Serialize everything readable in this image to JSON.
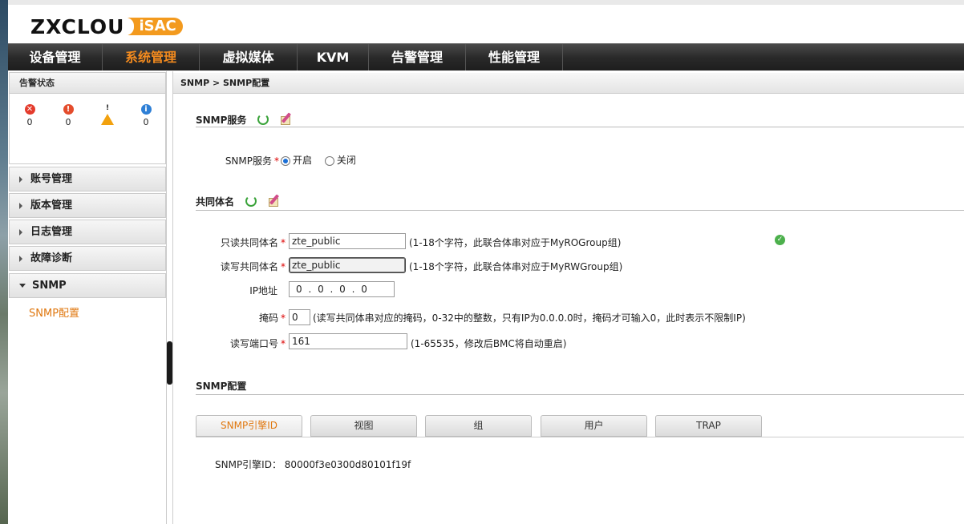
{
  "logo": {
    "text": "ZXCLOU",
    "mark": "iSAC"
  },
  "nav": {
    "items": [
      {
        "label": "设备管理",
        "active": false
      },
      {
        "label": "系统管理",
        "active": true
      },
      {
        "label": "虚拟媒体",
        "active": false
      },
      {
        "label": "KVM",
        "active": false
      },
      {
        "label": "告警管理",
        "active": false
      },
      {
        "label": "性能管理",
        "active": false
      }
    ]
  },
  "sidebar": {
    "alarm_title": "告警状态",
    "alarms": [
      {
        "icon": "critical-alarm-icon",
        "count": "0"
      },
      {
        "icon": "major-alarm-icon",
        "count": "0"
      },
      {
        "icon": "minor-alarm-icon",
        "count": "0"
      },
      {
        "icon": "info-alarm-icon",
        "count": "0"
      }
    ],
    "menu": [
      {
        "label": "账号管理"
      },
      {
        "label": "版本管理"
      },
      {
        "label": "日志管理"
      },
      {
        "label": "故障诊断"
      },
      {
        "label": "SNMP"
      }
    ],
    "submenu": {
      "label": "SNMP配置"
    }
  },
  "breadcrumb": "SNMP > SNMP配置",
  "snmp_service": {
    "section_title": "SNMP服务",
    "label": "SNMP服务",
    "required": "*",
    "options": {
      "on": "开启",
      "off": "关闭"
    },
    "selected": "on"
  },
  "community": {
    "section_title": "共同体名",
    "readonly_label": "只读共同体名",
    "readonly_value": "zte_public",
    "readonly_hint": "(1-18个字符，此联合体串对应于MyROGroup组)",
    "readwrite_label": "读写共同体名",
    "readwrite_value": "zte_public",
    "readwrite_hint": "(1-18个字符，此联合体串对应于MyRWGroup组)",
    "ip_label": "IP地址",
    "ip_value": "0 . 0 . 0 . 0",
    "mask_label": "掩码",
    "mask_value": "0",
    "mask_hint": "(读写共同体串对应的掩码，0-32中的整数，只有IP为0.0.0.0时，掩码才可输入0，此时表示不限制IP)",
    "port_label": "读写端口号",
    "port_value": "161",
    "port_hint": "(1-65535，修改后BMC将自动重启)",
    "required": "*"
  },
  "snmp_config": {
    "section_title": "SNMP配置",
    "tabs": [
      {
        "label": "SNMP引擎ID",
        "active": true
      },
      {
        "label": "视图",
        "active": false
      },
      {
        "label": "组",
        "active": false
      },
      {
        "label": "用户",
        "active": false
      },
      {
        "label": "TRAP",
        "active": false
      }
    ],
    "engine_id_label": "SNMP引擎ID：",
    "engine_id_value": "80000f3e0300d80101f19f"
  },
  "colors": {
    "accent": "#f28a1e",
    "nav_bg": "#2a2a2a",
    "required": "#dd0000",
    "ok": "#4cb04c"
  }
}
